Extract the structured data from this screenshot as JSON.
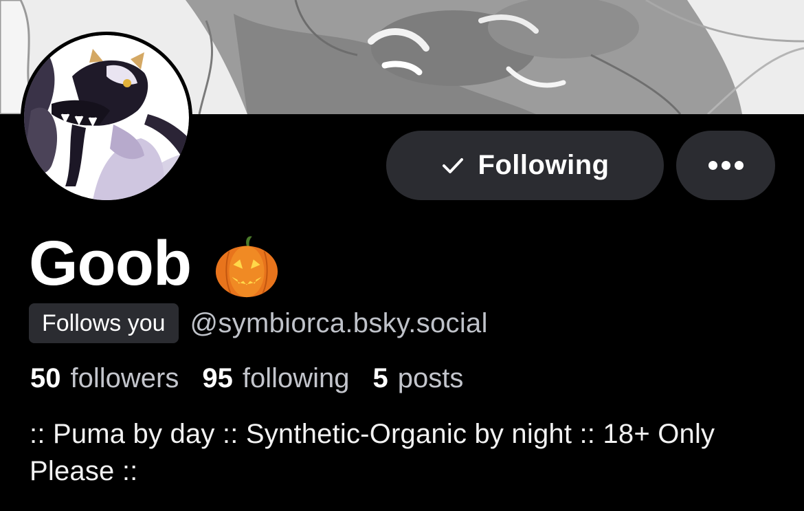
{
  "profile": {
    "display_name": "Goob",
    "name_emoji": "pumpkin-icon",
    "follows_you_label": "Follows you",
    "handle": "@symbiorca.bsky.social",
    "stats": {
      "followers_count": "50",
      "followers_label": "followers",
      "following_count": "95",
      "following_label": "following",
      "posts_count": "5",
      "posts_label": "posts"
    },
    "bio": ":: Puma by day :: Synthetic-Organic by night :: 18+ Only Please ::"
  },
  "actions": {
    "following_label": "Following",
    "following_icon": "check-icon",
    "more_icon": "more-dots-icon"
  },
  "colors": {
    "background": "#000000",
    "button_bg": "#2b2c31",
    "secondary_text": "#c3c5cc"
  }
}
